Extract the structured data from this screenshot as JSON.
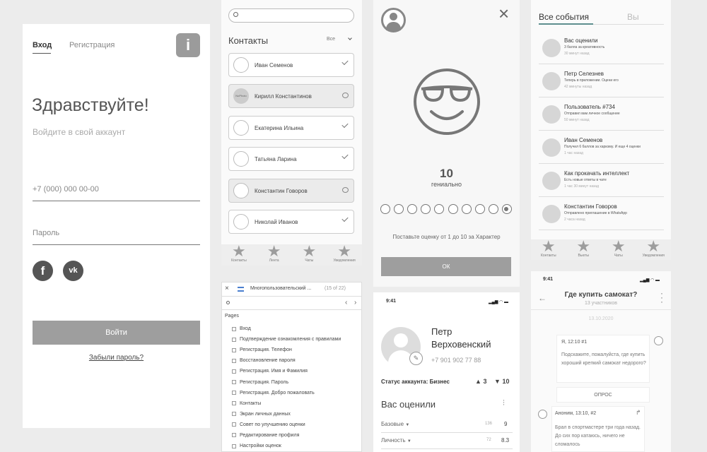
{
  "login": {
    "tab_login": "Вход",
    "tab_register": "Регистрация",
    "info_icon": "i",
    "title": "Здравствуйте!",
    "subtitle": "Войдите в свой аккаунт",
    "phone_placeholder": "+7 (000) 000 00-00",
    "password_placeholder": "Пароль",
    "facebook_glyph": "f",
    "vk_glyph": "vk",
    "login_button": "Войти",
    "forgot_link": "Забыли пароль?"
  },
  "contacts": {
    "title": "Контакты",
    "filter": "Все",
    "avatar_badge": "NoPhoto",
    "items": [
      {
        "name": "Иван Семенов",
        "status": "check",
        "shaded": false
      },
      {
        "name": "Кирилл Константинов",
        "status": "chat",
        "shaded": true
      },
      {
        "name": "Екатерина Ильина",
        "status": "check",
        "shaded": false
      },
      {
        "name": "Татьяна Ларина",
        "status": "check",
        "shaded": false
      },
      {
        "name": "Константин Говоров",
        "status": "chat",
        "shaded": true
      },
      {
        "name": "Николай Иванов",
        "status": "check",
        "shaded": false
      }
    ],
    "tabs": [
      "Контакты",
      "Лента",
      "Чаты",
      "Уведомления"
    ]
  },
  "rating": {
    "score": "10",
    "score_label": "гениально",
    "circle_count": 10,
    "selected_index": 9,
    "instruction": "Поставьте оценку от 1 до 10 за Характер",
    "ok_button": "ОК"
  },
  "events": {
    "tab_all": "Все события",
    "tab_you": "Вы",
    "items": [
      {
        "title": "Вас оценили",
        "desc": "3 балла за креативность",
        "time": "30 минут назад"
      },
      {
        "title": "Петр Селезнев",
        "desc": "Теперь в приложении. Оцени его",
        "time": "42 минуты назад"
      },
      {
        "title": "Пользователь #734",
        "desc": "Отправил вам личное сообщение",
        "time": "50 минут назад"
      },
      {
        "title": "Иван Семенов",
        "desc": "Получил 6 баллов за харизму. И еще 4 оценки",
        "time": "1 час назад"
      },
      {
        "title": "Как прокачать интеллект",
        "desc": "Есть новые ответы в чате",
        "time": "1 час 30 минут назад"
      },
      {
        "title": "Константин Говоров",
        "desc": "Отправлено приглашение в WhatsApp",
        "time": "2 часа назад"
      }
    ],
    "tabs": [
      "Контакты",
      "Вьюты",
      "Чаты",
      "Уведомления"
    ]
  },
  "sitemap": {
    "title": "Многопользовательский ...",
    "counter": "(15 of 22)",
    "section": "Pages",
    "pages": [
      "Вход",
      "Подтверждение ознакомления с правилами",
      "Регистрация. Телефон",
      "Восстановление пароля",
      "Регистрация. Имя и Фамилия",
      "Регистрация. Пароль",
      "Регистрация. Добро пожаловать",
      "Контакты",
      "Экран личных данных",
      "Совет по улучшению оценки",
      "Редактирование профиля",
      "Настройки оценок"
    ]
  },
  "profile": {
    "time": "9:41",
    "first_name": "Петр",
    "last_name": "Верховенский",
    "phone": "+7 901 902 77 88",
    "status": "Статус аккаунта: Бизнес",
    "likes": "3",
    "dislikes": "10",
    "section_title": "Вас оценили",
    "rows": [
      {
        "label": "Базовые",
        "votes": "136",
        "score": "9"
      },
      {
        "label": "Личность",
        "votes": "72",
        "score": "8.3"
      }
    ]
  },
  "chat": {
    "time": "9:41",
    "title": "Где купить самокат?",
    "participants": "13 участников",
    "date": "13.10.2020",
    "msg1_header": "Я, 12:10 #1",
    "msg1_text": "Подскажите, пожалуйста, где купить хороший крепкий самокат недорого?",
    "poll_label": "ОПРОС",
    "msg2_header": "Аноним, 13:10, #2",
    "msg2_text": "Брал в спортмастере три года назад. До сих пор катаюсь, ничего не сломалось"
  },
  "colors": {
    "accent_gray": "#9e9e9e",
    "events_accent": "#5e8f8f"
  }
}
